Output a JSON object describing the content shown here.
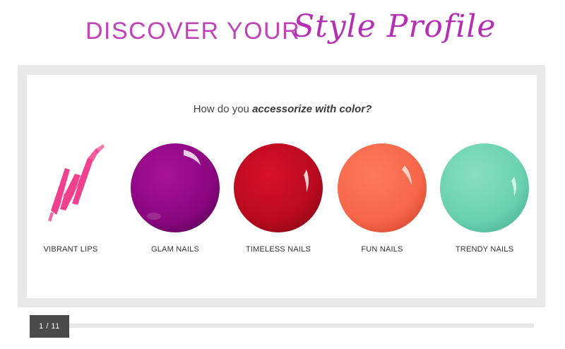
{
  "header": {
    "title_main": "DISCOVER YOUR",
    "title_script": "Style Profile"
  },
  "question": {
    "prefix": "How do you ",
    "emphasis": "accessorize with color?"
  },
  "options": [
    {
      "label": "VIBRANT LIPS",
      "color": "#f0418f",
      "icon": "lipstick-swatch-icon"
    },
    {
      "label": "GLAM NAILS",
      "color": "#8e087f",
      "icon": "nail-polish-swatch-icon"
    },
    {
      "label": "TIMELESS NAILS",
      "color": "#c10a22",
      "icon": "nail-polish-swatch-icon"
    },
    {
      "label": "FUN NAILS",
      "color": "#f66a4d",
      "icon": "nail-polish-swatch-icon"
    },
    {
      "label": "TRENDY NAILS",
      "color": "#6bd3b1",
      "icon": "nail-polish-swatch-icon"
    }
  ],
  "progress": {
    "text": "1 / 11",
    "current": 1,
    "total": 11
  },
  "colors": {
    "title_accent": "#c043b8",
    "frame": "#e8e8e8",
    "counter_bg": "#4a4a4a"
  }
}
